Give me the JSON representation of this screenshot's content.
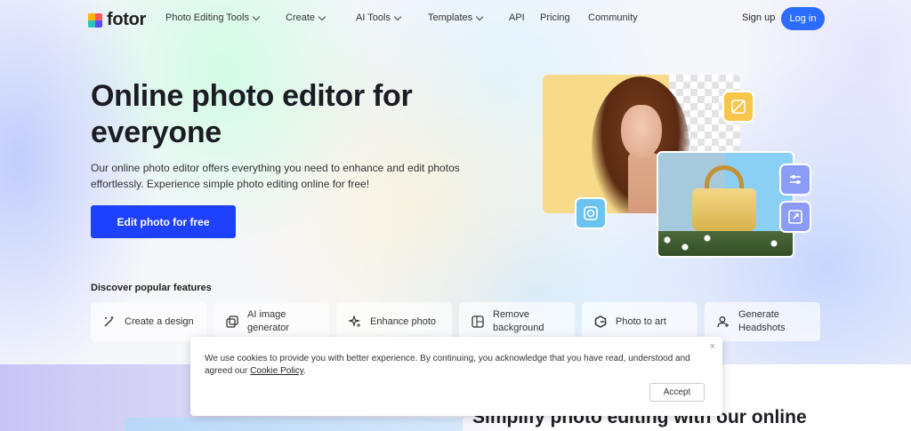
{
  "brand": {
    "name": "fotor"
  },
  "nav": {
    "items": [
      {
        "label": "Photo Editing Tools",
        "dropdown": true
      },
      {
        "label": "Create",
        "dropdown": true
      },
      {
        "label": "AI Tools",
        "dropdown": true
      },
      {
        "label": "Templates",
        "dropdown": true
      },
      {
        "label": "API",
        "dropdown": false
      },
      {
        "label": "Pricing",
        "dropdown": false
      },
      {
        "label": "Community",
        "dropdown": false
      }
    ],
    "signup": "Sign up",
    "login": "Log in"
  },
  "hero": {
    "title": "Online photo editor for everyone",
    "subtitle": "Our online photo editor offers everything you need to enhance and edit photos effortlessly. Experience simple photo editing online for free!",
    "cta": "Edit photo for free"
  },
  "features": {
    "title": "Discover popular features",
    "items": [
      {
        "label": "Create a design",
        "icon": "magic-wand-icon"
      },
      {
        "label": "AI image generator",
        "icon": "ai-image-icon"
      },
      {
        "label": "Enhance photo",
        "icon": "sparkle-icon"
      },
      {
        "label": "Remove background",
        "icon": "remove-bg-icon"
      },
      {
        "label": "Photo to art",
        "icon": "art-icon"
      },
      {
        "label": "Generate Headshots",
        "icon": "user-plus-icon"
      }
    ]
  },
  "cookie": {
    "text": "We use cookies to provide you with better experience. By continuing, you acknowledge that you have read, understood and agreed our ",
    "link": "Cookie Policy",
    "text_end": ".",
    "accept": "Accept",
    "close": "×"
  },
  "bottom_heading": "Simplify photo editing with our online",
  "colors": {
    "primary": "#1e40ff",
    "login": "#2c6cff"
  }
}
